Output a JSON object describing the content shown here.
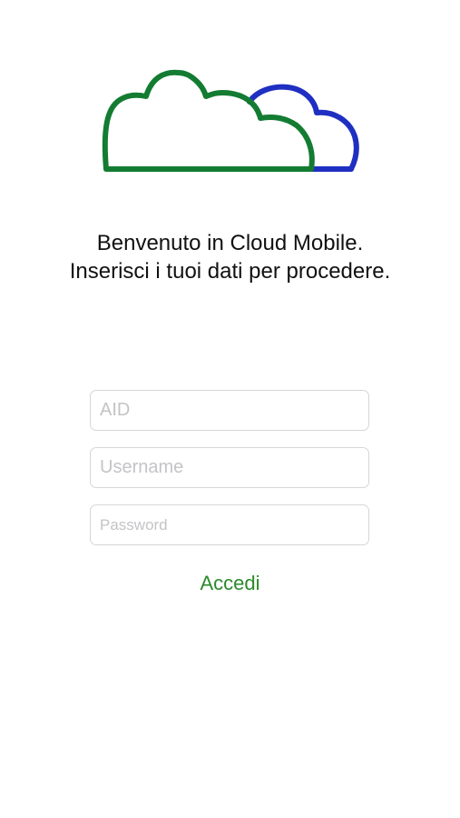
{
  "logo": {
    "icon": "cloud-logo-icon",
    "colors": {
      "front_cloud": "#137c32",
      "back_cloud": "#1f2fc1"
    }
  },
  "welcome": {
    "line1": "Benvenuto in Cloud Mobile.",
    "line2": "Inserisci i tuoi dati per procedere."
  },
  "form": {
    "aid": {
      "placeholder": "AID",
      "value": ""
    },
    "username": {
      "placeholder": "Username",
      "value": ""
    },
    "password": {
      "placeholder": "Password",
      "value": ""
    },
    "submit_label": "Accedi"
  },
  "colors": {
    "background": "#ffffff",
    "text": "#111111",
    "accent": "#2b8a2b",
    "field_border": "#d6d6d6",
    "placeholder": "#c4c4c7"
  }
}
